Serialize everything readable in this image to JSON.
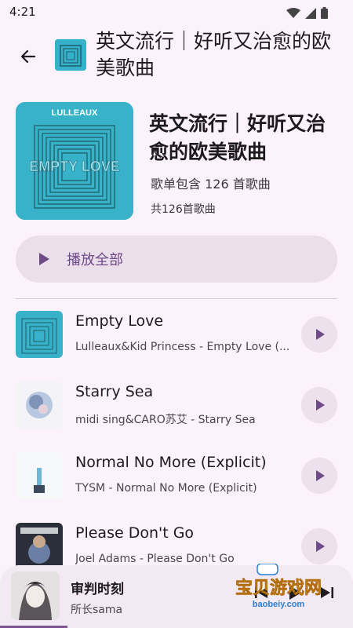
{
  "status": {
    "time": "4:21"
  },
  "header": {
    "title": "英文流行｜好听又治愈的欧美歌曲"
  },
  "playlist": {
    "title": "英文流行｜好听又治愈的欧美歌曲",
    "description": "歌单包含 126 首歌曲",
    "count": "共126首歌曲",
    "cover_label": "LULLEAUX",
    "cover_art_text": "EMPTY LOVE"
  },
  "play_all": {
    "label": "播放全部"
  },
  "songs": [
    {
      "title": "Empty Love",
      "subtitle": "Lulleaux&Kid Princess - Empty Love (..."
    },
    {
      "title": "Starry Sea",
      "subtitle": "midi sing&CARO苏艾 - Starry Sea"
    },
    {
      "title": "Normal No More (Explicit)",
      "subtitle": "TYSM - Normal No More (Explicit)"
    },
    {
      "title": "Please Don't Go",
      "subtitle": "Joel Adams - Please Don't Go"
    }
  ],
  "mini_player": {
    "title": "审判时刻",
    "artist": "所长sama",
    "progress": 0.19
  },
  "watermark": {
    "text": "宝贝游戏网",
    "url": "baobeiy.com"
  },
  "colors": {
    "accent": "#6e4a86",
    "background": "#fcf2fb",
    "cover": "#37b2c9"
  }
}
